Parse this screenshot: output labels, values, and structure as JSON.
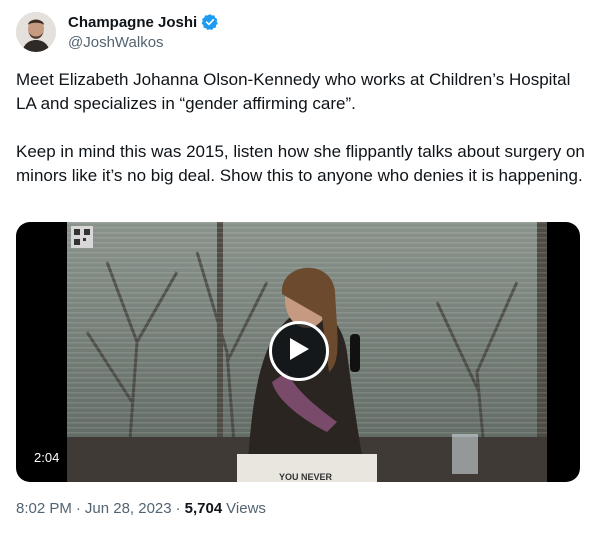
{
  "author": {
    "display_name": "Champagne Joshi",
    "handle": "@JoshWalkos",
    "verified": true,
    "badge_color": "#1d9bf0"
  },
  "tweet": {
    "paragraphs": [
      "Meet Elizabeth Johanna Olson-Kennedy who works at Children’s Hospital LA and specializes in “gender affirming care”.",
      "Keep in mind this was 2015, listen how she flippantly talks about surgery on minors like it’s no big deal. Show this to anyone who denies it is happening."
    ]
  },
  "video": {
    "duration": "2:04",
    "sign_text": "YOU NEVER",
    "play_icon": "play-icon"
  },
  "meta": {
    "time": "8:02 PM",
    "separator": "·",
    "date": "Jun 28, 2023",
    "views_count": "5,704",
    "views_label": "Views"
  }
}
